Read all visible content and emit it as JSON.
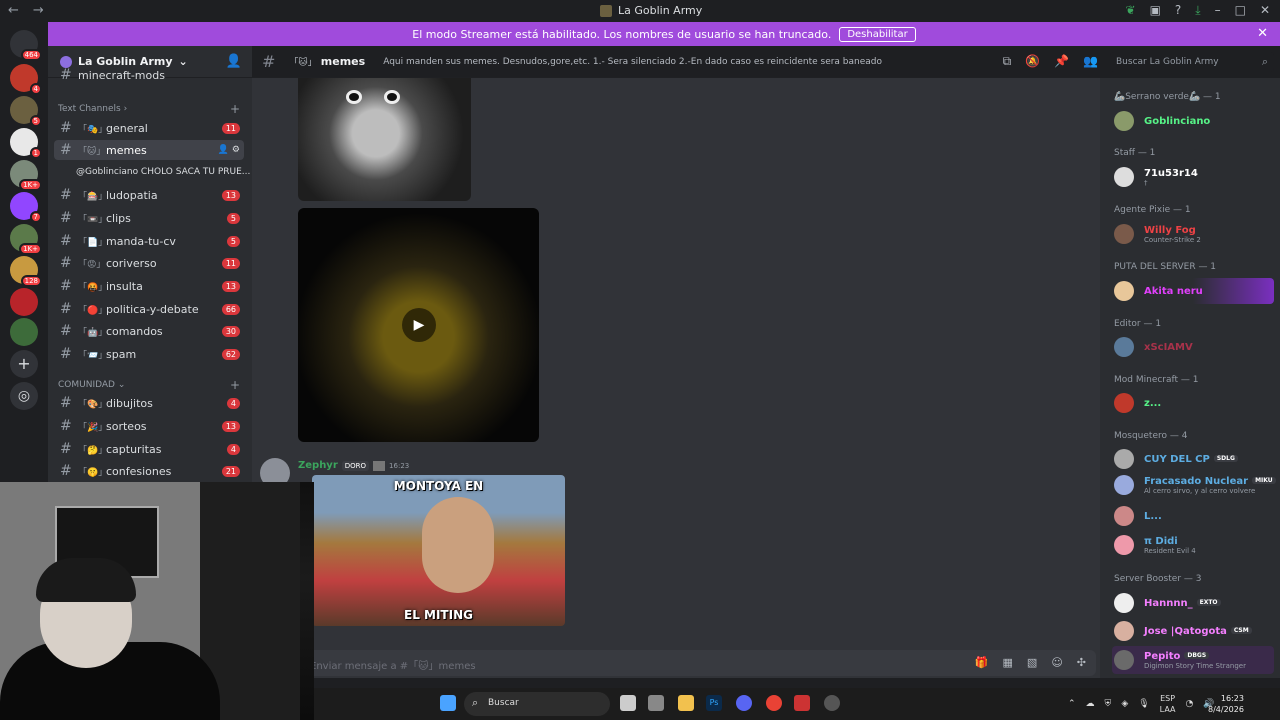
{
  "window": {
    "title": "La Goblin Army",
    "back": "←",
    "forward": "→"
  },
  "banner": {
    "text": "El modo Streamer está habilitado. Los nombres de usuario se han truncado.",
    "button": "Deshabilitar"
  },
  "servers": {
    "badges": [
      "464",
      "4",
      "5",
      "1",
      "1K+",
      "7",
      "1K+",
      "128"
    ]
  },
  "guild": {
    "name": "La Goblin Army"
  },
  "channels": {
    "top_partial": "minecraft-mods",
    "categories": [
      "Text Channels",
      "COMUNIDAD"
    ],
    "items": [
      {
        "name": "general",
        "emoji": "「🎭」",
        "count": "11"
      },
      {
        "name": "memes",
        "emoji": "「🐱」",
        "count": ""
      },
      {
        "name": "ludopatia",
        "emoji": "「🎰」",
        "count": "13"
      },
      {
        "name": "clips",
        "emoji": "「📼」",
        "count": "5"
      },
      {
        "name": "manda-tu-cv",
        "emoji": "「📄」",
        "count": "5"
      },
      {
        "name": "coriverso",
        "emoji": "「😡」",
        "count": "11"
      },
      {
        "name": "insulta",
        "emoji": "「🤬」",
        "count": "13"
      },
      {
        "name": "politica-y-debate",
        "emoji": "「🔴」",
        "count": "66"
      },
      {
        "name": "comandos",
        "emoji": "「🤖」",
        "count": "30"
      },
      {
        "name": "spam",
        "emoji": "「📨」",
        "count": "62"
      },
      {
        "name": "dibujitos",
        "emoji": "「🎨」",
        "count": "4"
      },
      {
        "name": "sorteos",
        "emoji": "「🎉」",
        "count": "13"
      },
      {
        "name": "capturitas",
        "emoji": "「🤔」",
        "count": "4"
      },
      {
        "name": "confesiones",
        "emoji": "「🤫」",
        "count": "21"
      }
    ],
    "thread": "@Goblinciano CHOLO SACA TU PRUE..."
  },
  "topbar": {
    "channel": "memes",
    "emoji": "「🐱」",
    "topic": "Aqui manden sus memes. Desnudos,gore,etc. 1.- Sera silenciado 2.-En dado caso es reincidente sera baneado",
    "search_placeholder": "Buscar La Goblin Army"
  },
  "message": {
    "author": "Zephyr",
    "badge": "DORO",
    "time": "16:23",
    "meme_top": "MONTOYA EN",
    "meme_bottom": "EL MITING"
  },
  "composer": {
    "placeholder": "Enviar mensaje a #「🐱」memes"
  },
  "members": {
    "roles": [
      "🦾Serrano verde🦾 — 1",
      "Staff — 1",
      "Agente Pixie — 1",
      "PUTA DEL SERVER — 1",
      "Editor — 1",
      "Mod Minecraft — 1",
      "Mosquetero — 4",
      "Server Booster — 3"
    ],
    "list": [
      {
        "name": "Goblinciano",
        "activity": "",
        "badge": "",
        "color": "#57f287"
      },
      {
        "name": "71u53r14",
        "activity": "†",
        "badge": "",
        "color": "#ffffff"
      },
      {
        "name": "Willy Fog",
        "activity": "Counter-Strike 2",
        "badge": "",
        "color": "#ed4245"
      },
      {
        "name": "Akita neru",
        "activity": "",
        "badge": "",
        "color": "#e040fb"
      },
      {
        "name": "xScIAMV",
        "activity": "",
        "badge": "",
        "color": "#a8324a"
      },
      {
        "name": "z...",
        "activity": "",
        "badge": "",
        "color": "#57f287"
      },
      {
        "name": "CUY DEL CP",
        "activity": "",
        "badge": "SDLG",
        "color": "#5dade2"
      },
      {
        "name": "Fracasado Nuclear",
        "activity": "Al cerro sirvo, y al cerro volvere",
        "badge": "MIKU",
        "color": "#5dade2"
      },
      {
        "name": "L...",
        "activity": "",
        "badge": "",
        "color": "#5dade2"
      },
      {
        "name": "π Didi",
        "activity": "Resident Evil 4",
        "badge": "",
        "color": "#5dade2"
      },
      {
        "name": "Hannnn_",
        "activity": "",
        "badge": "EXTO",
        "color": "#f47fff"
      },
      {
        "name": "Jose |Qatogota",
        "activity": "",
        "badge": "CSM",
        "color": "#f47fff"
      },
      {
        "name": "Pepito",
        "activity": "Digimon Story Time Stranger",
        "badge": "DBGS",
        "color": "#f47fff"
      }
    ]
  },
  "taskbar": {
    "search": "Buscar",
    "lang1": "ESP",
    "lang2": "LAA",
    "time": "16:23",
    "date": "8/4/2026"
  }
}
